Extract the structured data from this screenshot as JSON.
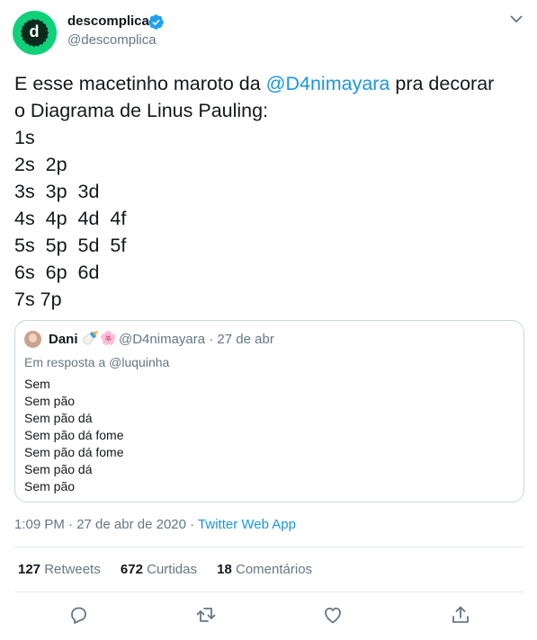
{
  "author": {
    "display_name": "descomplica",
    "handle": "@descomplica",
    "avatar_letter": "d",
    "avatar_color": "#0fd17a"
  },
  "tweet": {
    "lines": [
      [
        "E esse macetinho maroto da ",
        "@D4nimayara",
        " pra decorar"
      ],
      [
        "o Diagrama de Linus Pauling:"
      ],
      [
        "1s"
      ],
      [
        "2s  2p"
      ],
      [
        "3s  3p  3d"
      ],
      [
        "4s  4p  4d  4f"
      ],
      [
        "5s  5p  5d  5f"
      ],
      [
        "6s  6p  6d"
      ],
      [
        "7s 7p"
      ]
    ]
  },
  "quote": {
    "name": "Dani",
    "emojis": [
      "🍼",
      "🌸"
    ],
    "handle_time": "@D4nimayara · 27 de abr",
    "reply_to": "Em resposta a @luquinha",
    "lines": [
      "Sem",
      "Sem pão",
      "Sem pão dá",
      "Sem pão dá fome",
      "Sem pão dá fome",
      "Sem pão dá",
      "Sem pão"
    ]
  },
  "meta": {
    "timestamp": "1:09 PM · 27 de abr de 2020 · ",
    "app": "Twitter Web App"
  },
  "stats": {
    "retweets_count": "127",
    "retweets_label": " Retweets",
    "likes_count": "672",
    "likes_label": " Curtidas",
    "comments_count": "18",
    "comments_label": " Comentários"
  },
  "icons": {
    "verified": "verified-badge-icon",
    "caret": "chevron-down-icon",
    "reply": "reply-icon",
    "retweet": "retweet-icon",
    "like": "heart-icon",
    "share": "share-icon"
  },
  "colors": {
    "link": "#1b95e0",
    "secondary_text": "#657786",
    "border": "#ccd6dd"
  }
}
